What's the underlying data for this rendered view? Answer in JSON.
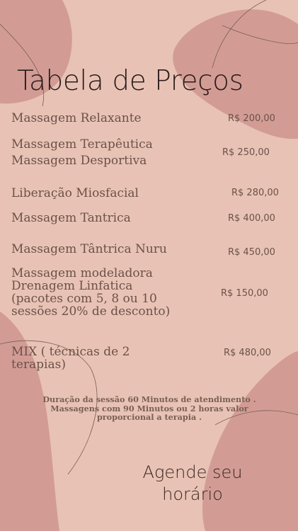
{
  "header": {
    "title": "Tabela de Preços"
  },
  "price_list": {
    "items": [
      {
        "name": "Massagem Relaxante",
        "price": "R$ 200,00"
      },
      {
        "name": "Massagem Terapêutica\nMassagem Desportiva",
        "price": "R$ 250,00"
      },
      {
        "name": "Liberação Miosfacial",
        "price": "R$ 280,00"
      },
      {
        "name": "Massagem Tantrica",
        "price": "R$ 400,00"
      },
      {
        "name": "Massagem Tântrica Nuru",
        "price": "R$ 450,00"
      },
      {
        "name": "Massagem modeladora\nDrenagem Linfatica\n(pacotes com 5, 8 ou 10\nsessões 20% de desconto)",
        "price": "R$ 150,00"
      },
      {
        "name": "MIX ( técnicas de 2\nterapias)",
        "price": "R$ 480,00"
      }
    ]
  },
  "note": {
    "text": "Duração da sessão 60 Minutos de atendimento . Massagens com 90 Minutos ou 2 horas valor proporcional a terapia ."
  },
  "cta": {
    "line1": "Agende seu",
    "line2": "horário"
  },
  "colors": {
    "background": "#e8c3b5",
    "blob": "#d29c95",
    "line": "#7a5e54",
    "text": "#6b5148"
  }
}
